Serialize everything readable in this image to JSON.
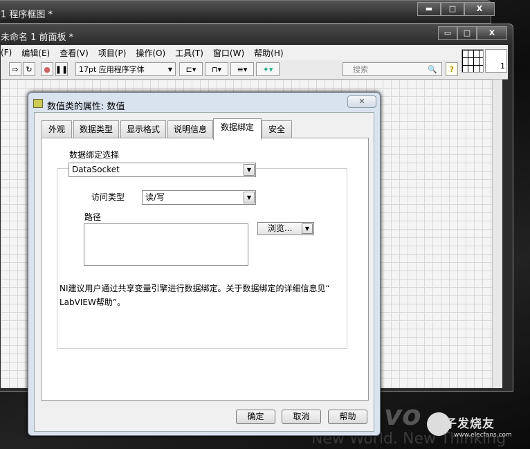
{
  "back_window": {
    "title": "1 程序框图 *",
    "buttons": [
      "▬",
      "□",
      "X"
    ]
  },
  "front_window": {
    "title": "未命名 1 前面板 *",
    "buttons": [
      "▭",
      "□",
      "X"
    ]
  },
  "menu": [
    "(F)",
    "编辑(E)",
    "查看(V)",
    "项目(P)",
    "操作(O)",
    "工具(T)",
    "窗口(W)",
    "帮助(H)"
  ],
  "toolbar": {
    "font": "17pt 应用程序字体",
    "search_placeholder": "搜索",
    "help": "?",
    "connector_num": "1"
  },
  "dialog": {
    "title": "数值类的属性: 数值",
    "close": "✕",
    "tabs": [
      "外观",
      "数据类型",
      "显示格式",
      "说明信息",
      "数据绑定",
      "安全"
    ],
    "active_tab": "数据绑定",
    "binding_label": "数据绑定选择",
    "binding_value": "DataSocket",
    "access_label": "访问类型",
    "access_value": "读/写",
    "path_label": "路径",
    "path_value": "",
    "browse": "浏览...",
    "note_line1": "NI建议用户通过共享变量引擎进行数据绑定。关于数据绑定的详细信息见“",
    "note_line2": "LabVIEW帮助”。",
    "ok": "确定",
    "cancel": "取消",
    "help": "帮助"
  },
  "watermark": {
    "brand": "电子发烧友",
    "url": "www.elecfans.com",
    "slogan": "New World. New Thinking",
    "partial": "vo"
  }
}
